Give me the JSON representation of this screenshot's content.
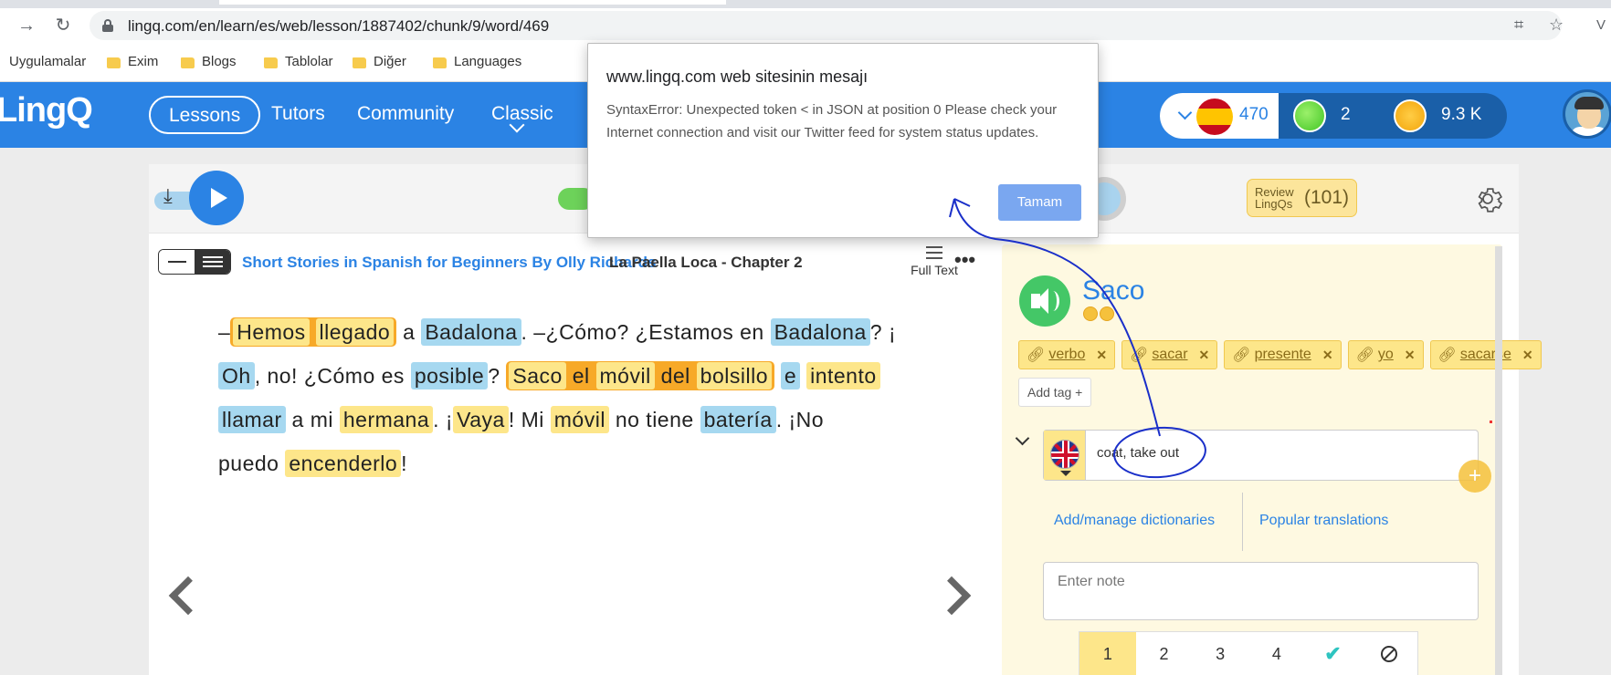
{
  "browser": {
    "url": "lingq.com/en/learn/es/web/lesson/1887402/chunk/9/word/469",
    "bookmarks": [
      "Uygulamalar",
      "Exim",
      "Blogs",
      "Tablolar",
      "Diğer",
      "Languages"
    ],
    "profile_initial": "V"
  },
  "header": {
    "logo": "LingQ",
    "nav": [
      "Lessons",
      "Tutors",
      "Community",
      "Classic"
    ],
    "stats": {
      "known_words": "470",
      "lingqs_today": "2",
      "coins": "9.3 K"
    }
  },
  "toolbar": {
    "review_label": "Review LingQs",
    "review_count": "(101)"
  },
  "lesson": {
    "course": "Short Stories in Spanish for Beginners By Olly Richards",
    "title": "La Paella Loca - Chapter 2",
    "full_text": "Full Text",
    "more": "•••",
    "text": {
      "l1_a": "–",
      "w_hemos": "Hemos",
      "w_llegado": "llegado",
      "t_a": " a ",
      "w_badalona1": "Badalona",
      "t_como": ". –¿Cómo? ¿Estamos en ",
      "w_badalona2": "Badalona",
      "t_q": "? ¡",
      "w_oh": "Oh",
      "t_no": ", no! ¿Cómo es ",
      "w_posible": "posible",
      "t_q2": "? ",
      "w_saco": "Saco",
      "w_el": "el",
      "w_movil": "móvil",
      "w_del": "del",
      "w_bolsillo": "bolsillo",
      "t_sp": " ",
      "w_e": "e",
      "w_intento": "intento",
      "w_llamar": "llamar",
      "t_ami": " a mi ",
      "w_hermana": "hermana",
      "t_vaya_a": ". ¡",
      "w_vaya": "Vaya",
      "t_mi": "! Mi ",
      "w_movil2": "móvil",
      "t_notiene": " no tiene ",
      "w_bateria": "batería",
      "t_nopuedo": ". ¡No",
      "t_puedo": "puedo ",
      "w_encenderlo": "encenderlo",
      "t_end": "!"
    }
  },
  "word_panel": {
    "word": "Saco",
    "tags": [
      "verbo",
      "sacar",
      "presente",
      "yo",
      "sacarse"
    ],
    "add_tag": "Add tag +",
    "translation": "coat, take out",
    "dict_link": "Add/manage dictionaries",
    "popular_link": "Popular translations",
    "note_placeholder": "Enter note",
    "statuses": [
      "1",
      "2",
      "3",
      "4",
      "✔"
    ]
  },
  "dialog": {
    "title": "www.lingq.com web sitesinin mesajı",
    "message": "SyntaxError: Unexpected token < in JSON at position 0 Please check your Internet connection and visit our Twitter feed for system status updates.",
    "ok": "Tamam"
  },
  "colors": {
    "brand_blue": "#2b83e4",
    "known_blue": "#a6d8f0",
    "lingq_yellow": "#fde68a",
    "selected_orange": "#f7a928",
    "annotation_ink": "#1a2fc9"
  }
}
